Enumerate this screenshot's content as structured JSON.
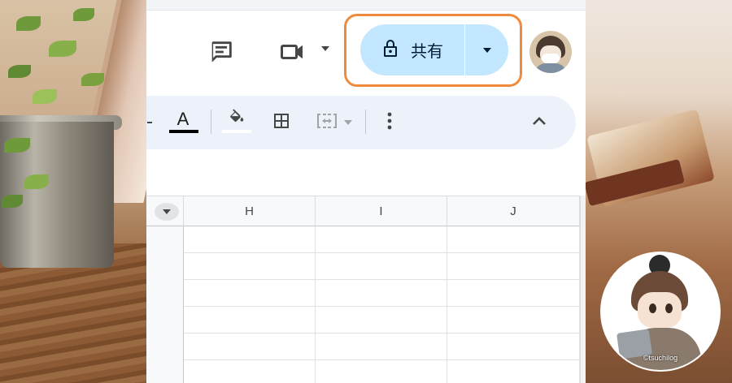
{
  "header": {
    "comments_icon": "comment-icon",
    "meet_icon": "videocam-icon",
    "share": {
      "label": "共有",
      "icon": "lock-icon",
      "menu_icon": "caret-down-icon",
      "background": "#c2e7ff"
    },
    "highlight_color": "#f08a3c"
  },
  "toolbar": {
    "items": [
      {
        "name": "text-color",
        "glyph": "A",
        "underline_color": "#000000"
      },
      {
        "name": "fill-color",
        "icon": "paint-bucket-icon",
        "underline_color": "#ffffff"
      },
      {
        "name": "borders",
        "icon": "borders-icon"
      },
      {
        "name": "merge-cells",
        "icon": "merge-cells-icon",
        "disabled": true
      },
      {
        "name": "more",
        "icon": "more-vert-icon"
      },
      {
        "name": "collapse",
        "icon": "chevron-up-icon"
      }
    ],
    "background": "#edf2fa"
  },
  "sheet": {
    "columns": [
      "H",
      "I",
      "J"
    ],
    "visible_rows": 6
  },
  "watermark": {
    "credit": "©tsuchilog"
  }
}
